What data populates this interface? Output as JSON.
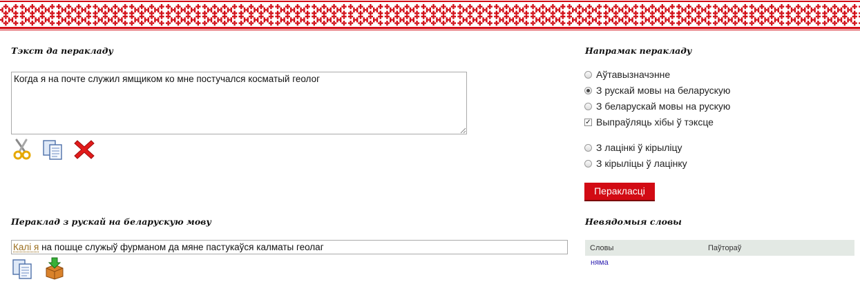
{
  "source": {
    "heading": "Тэкст да перакладу",
    "text": "Когда я на почте служил ямщиком ко мне постучался косматый геолог",
    "icons": [
      "scissors-icon",
      "copy-icon",
      "delete-icon"
    ]
  },
  "direction": {
    "heading": "Напрамак перакладу",
    "options": [
      {
        "label": "Аўтавызначэнне",
        "selected": false
      },
      {
        "label": "З рускай мовы на беларускую",
        "selected": true
      },
      {
        "label": "З беларускай мовы на рускую",
        "selected": false
      }
    ],
    "spellcheck": {
      "label": "Выпраўляць хібы ў тэксце",
      "checked": true
    },
    "script_options": [
      {
        "label": "З лацінкі ў кірыліцу",
        "selected": false
      },
      {
        "label": "З кірыліцы ў лацінку",
        "selected": false
      }
    ],
    "translate_button": "Перакласці"
  },
  "result": {
    "heading": "Пераклад з рускай на беларускую мову",
    "flagged": "Калі я",
    "text": " на пошце служыў фурманом да мяне пастукаўся калматы геолаг",
    "icons": [
      "copy-icon",
      "download-icon"
    ]
  },
  "unknown_words": {
    "heading": "Невядомыя словы",
    "columns": [
      "Словы",
      "Паўтораў"
    ],
    "rows": [
      "няма"
    ]
  },
  "colors": {
    "accent": "#d20b14",
    "link": "#2a1db0",
    "flagged_word": "#9b6f20",
    "table_header": "#e3e9e4"
  }
}
